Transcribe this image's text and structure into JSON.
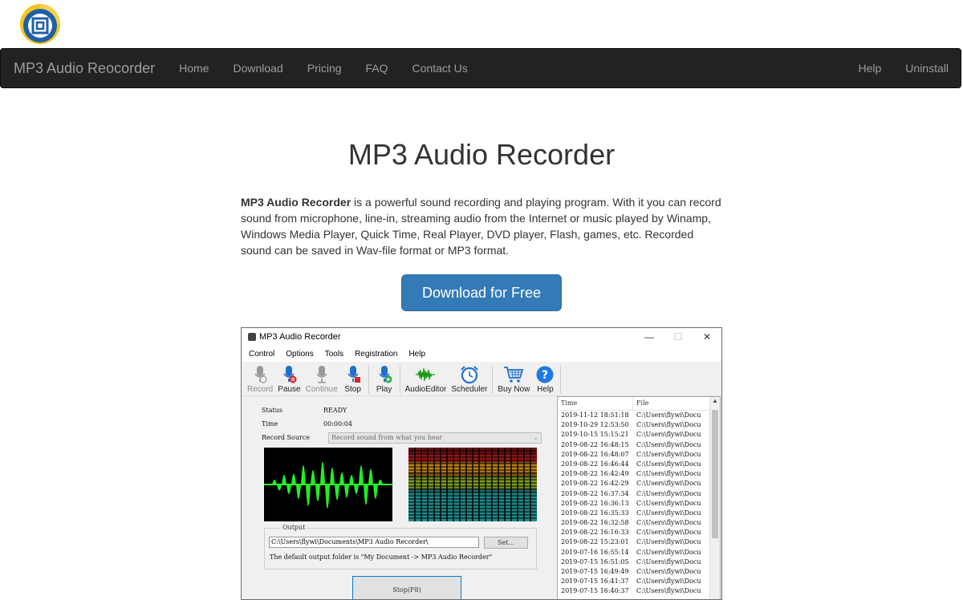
{
  "nav": {
    "brand": "MP3 Audio Reocorder",
    "links": [
      "Home",
      "Download",
      "Pricing",
      "FAQ",
      "Contact Us"
    ],
    "right_links": [
      "Help",
      "Uninstall"
    ]
  },
  "hero": {
    "title": "MP3 Audio Recorder",
    "desc_bold": "MP3 Audio Recorder",
    "desc_rest": " is a powerful sound recording and playing program. With it you can record sound from microphone, line-in, streaming audio from the Internet or music played by Winamp, Windows Media Player, Quick Time, Real Player, DVD player, Flash, games, etc. Recorded sound can be saved in Wav-file format or MP3 format.",
    "button": "Download for Free"
  },
  "app": {
    "title": "MP3 Audio Recorder",
    "win_controls": [
      "—",
      "☐",
      "✕"
    ],
    "menu": [
      "Control",
      "Options",
      "Tools",
      "Registration",
      "Help"
    ],
    "tools": [
      {
        "label": "Record",
        "icon": "microphone-icon"
      },
      {
        "label": "Pause",
        "icon": "microphone-pause-icon"
      },
      {
        "label": "Continue",
        "icon": "microphone-icon"
      },
      {
        "label": "Stop",
        "icon": "microphone-stop-icon"
      },
      {
        "label": "Play",
        "icon": "microphone-play-icon"
      },
      {
        "label": "AudioEditor",
        "icon": "waveform-icon"
      },
      {
        "label": "Scheduler",
        "icon": "alarm-clock-icon"
      },
      {
        "label": "Buy Now",
        "icon": "cart-icon"
      },
      {
        "label": "Help",
        "icon": "help-icon"
      }
    ],
    "status_label": "Status",
    "status_value": "READY",
    "time_label": "Time",
    "time_value": "00:00:04",
    "source_label": "Record Source",
    "source_value": "Record sound from what you hear",
    "output_label": "Output",
    "output_path": "C:\\Users\\flywi\\Documents\\MP3 Audio Recorder\\",
    "set_button": "Set...",
    "output_note": "The default output folder is \"My Document -> MP3 Audio Recorder\"",
    "stop_button": "Stop(F8)",
    "list_headers": [
      "Time",
      "File"
    ],
    "list_rows": [
      [
        "2019-11-12 18:51:18",
        "C:\\Users\\flywi\\Docu"
      ],
      [
        "2019-10-29 12:53:50",
        "C:\\Users\\flywi\\Docu"
      ],
      [
        "2019-10-15 15:15:21",
        "C:\\Users\\flywi\\Docu"
      ],
      [
        "2019-08-22 16:48:15",
        "C:\\Users\\flywi\\Docu"
      ],
      [
        "2019-08-22 16:48:07",
        "C:\\Users\\flywi\\Docu"
      ],
      [
        "2019-08-22 16:46:44",
        "C:\\Users\\flywi\\Docu"
      ],
      [
        "2019-08-22 16:42:49",
        "C:\\Users\\flywi\\Docu"
      ],
      [
        "2019-08-22 16:42:29",
        "C:\\Users\\flywi\\Docu"
      ],
      [
        "2019-08-22 16:37:34",
        "C:\\Users\\flywi\\Docu"
      ],
      [
        "2019-08-22 16:36:13",
        "C:\\Users\\flywi\\Docu"
      ],
      [
        "2019-08-22 16:35:33",
        "C:\\Users\\flywi\\Docu"
      ],
      [
        "2019-08-22 16:32:58",
        "C:\\Users\\flywi\\Docu"
      ],
      [
        "2019-08-22 16:16:33",
        "C:\\Users\\flywi\\Docu"
      ],
      [
        "2019-08-22 15:23:01",
        "C:\\Users\\flywi\\Docu"
      ],
      [
        "2019-07-16 16:55:14",
        "C:\\Users\\flywi\\Docu"
      ],
      [
        "2019-07-15 16:51:05",
        "C:\\Users\\flywi\\Docu"
      ],
      [
        "2019-07-15 16:49:49",
        "C:\\Users\\flywi\\Docu"
      ],
      [
        "2019-07-15 16:41:37",
        "C:\\Users\\flywi\\Docu"
      ],
      [
        "2019-07-15 16:40:37",
        "C:\\Users\\flywi\\Docu"
      ]
    ]
  },
  "colors": {
    "navbar": "#222222",
    "nav_text": "#9d9d9d",
    "primary": "#337ab7",
    "wave": "#22ee22"
  }
}
